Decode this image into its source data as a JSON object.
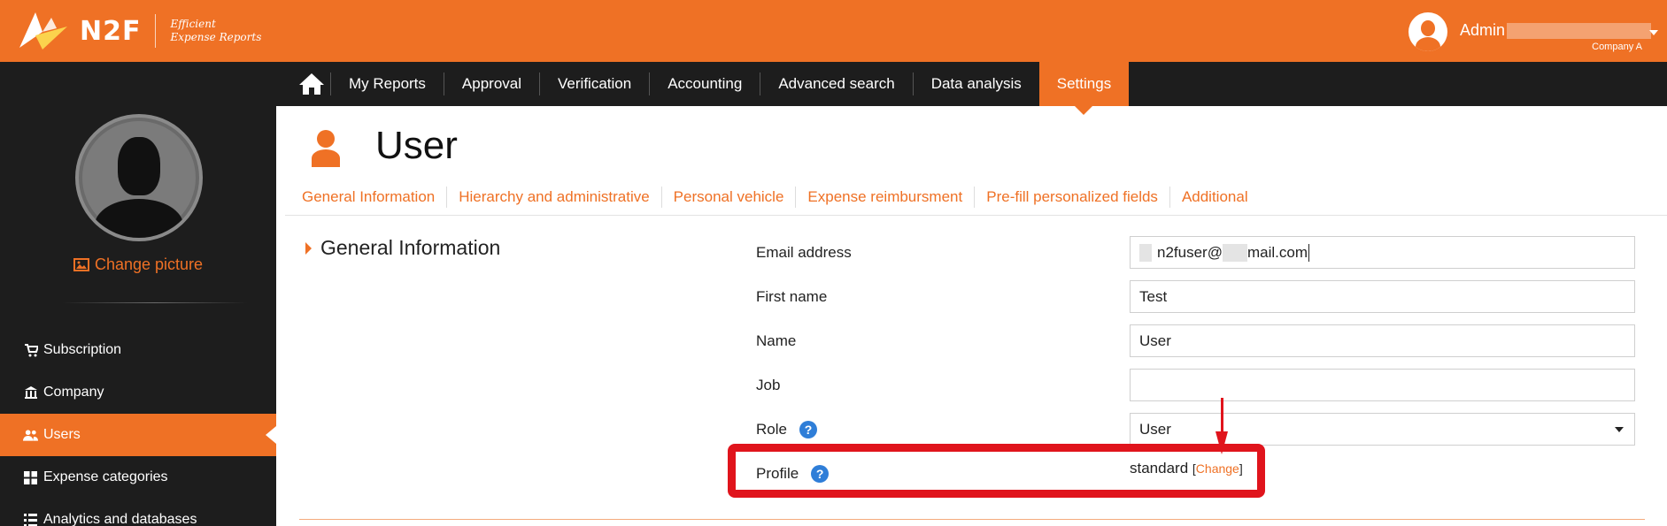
{
  "app": {
    "logo_text": "N2F",
    "tagline_line1": "Efficient",
    "tagline_line2": "Expense Reports",
    "brand_color": "#ef7125"
  },
  "user": {
    "name": "Admin",
    "company": "Company A"
  },
  "nav": {
    "home_icon": "home-icon",
    "items": [
      {
        "label": "My Reports"
      },
      {
        "label": "Approval"
      },
      {
        "label": "Verification"
      },
      {
        "label": "Accounting"
      },
      {
        "label": "Advanced search"
      },
      {
        "label": "Data analysis"
      },
      {
        "label": "Settings",
        "active": true
      }
    ]
  },
  "sidebar": {
    "change_picture": "Change picture",
    "items": [
      {
        "label": "Subscription",
        "icon": "cart-icon"
      },
      {
        "label": "Company",
        "icon": "bank-icon"
      },
      {
        "label": "Users",
        "icon": "users-icon",
        "active": true
      },
      {
        "label": "Expense categories",
        "icon": "grid-icon"
      },
      {
        "label": "Analytics and databases",
        "icon": "list-icon"
      }
    ]
  },
  "page": {
    "title": "User",
    "tabs": [
      {
        "label": "General Information"
      },
      {
        "label": "Hierarchy and administrative"
      },
      {
        "label": "Personal vehicle"
      },
      {
        "label": "Expense reimbursment"
      },
      {
        "label": "Pre-fill personalized fields"
      },
      {
        "label": "Additional"
      }
    ],
    "section_title": "General Information"
  },
  "form": {
    "email_label": "Email address",
    "email_value_a": "n2fuser@",
    "email_value_b": "mail.com",
    "first_name_label": "First name",
    "first_name_value": "Test",
    "name_label": "Name",
    "name_value": "User",
    "job_label": "Job",
    "job_value": "",
    "role_label": "Role",
    "role_value": "User",
    "profile_label": "Profile",
    "profile_value": "standard",
    "profile_change": "Change",
    "help_glyph": "?"
  },
  "annotation_color": "#e0141c"
}
